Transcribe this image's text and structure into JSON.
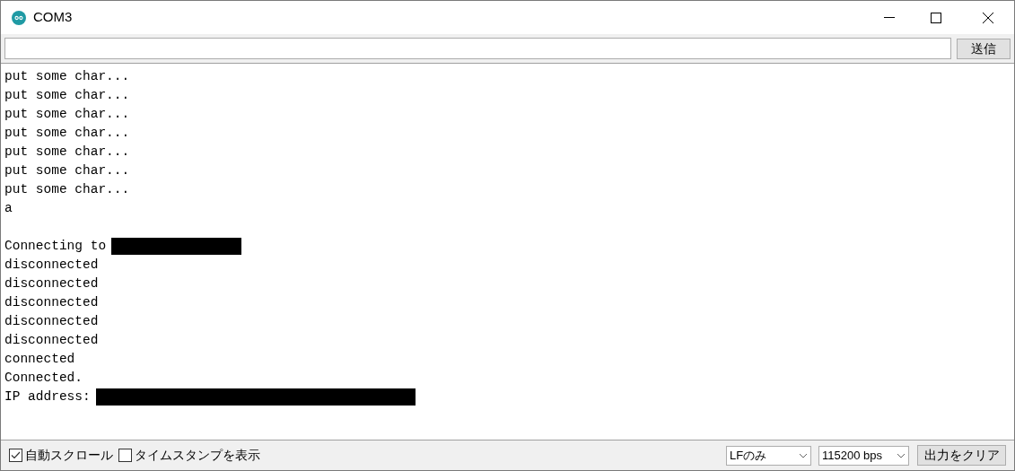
{
  "window": {
    "title": "COM3"
  },
  "input": {
    "send_button": "送信"
  },
  "output": {
    "lines": [
      {
        "kind": "text",
        "text": "put some char..."
      },
      {
        "kind": "text",
        "text": "put some char..."
      },
      {
        "kind": "text",
        "text": "put some char..."
      },
      {
        "kind": "text",
        "text": "put some char..."
      },
      {
        "kind": "text",
        "text": "put some char..."
      },
      {
        "kind": "text",
        "text": "put some char..."
      },
      {
        "kind": "text",
        "text": "put some char..."
      },
      {
        "kind": "text",
        "text": "a"
      },
      {
        "kind": "blank"
      },
      {
        "kind": "mask",
        "text": "Connecting to"
      },
      {
        "kind": "text",
        "text": "disconnected"
      },
      {
        "kind": "text",
        "text": "disconnected"
      },
      {
        "kind": "text",
        "text": "disconnected"
      },
      {
        "kind": "text",
        "text": "disconnected"
      },
      {
        "kind": "text",
        "text": "disconnected"
      },
      {
        "kind": "text",
        "text": "connected"
      },
      {
        "kind": "text",
        "text": "Connected."
      },
      {
        "kind": "widemask",
        "text": "IP address:"
      }
    ]
  },
  "status_bar": {
    "checkboxes": [
      {
        "label": "自動スクロール",
        "checked": true
      },
      {
        "label": "タイムスタンプを表示",
        "checked": false
      }
    ],
    "line_ending": "LFのみ",
    "baud_rate": "115200 bps",
    "clear_button": "出力をクリア"
  }
}
